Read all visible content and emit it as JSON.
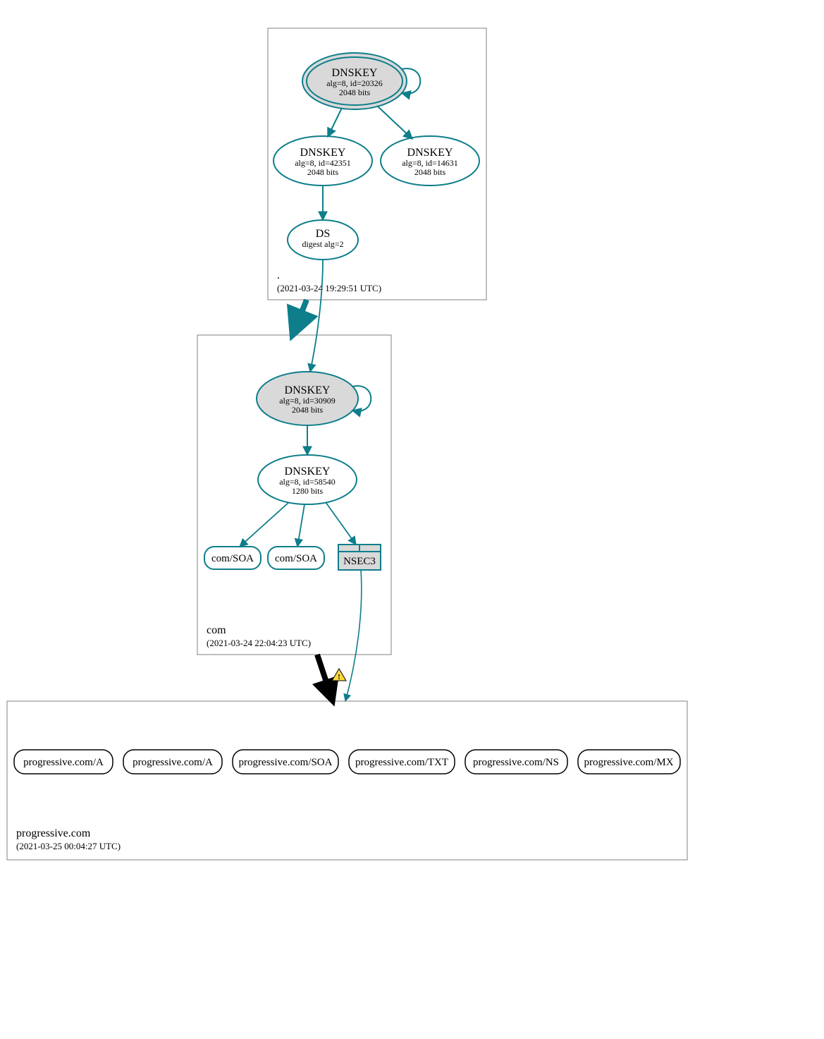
{
  "colors": {
    "teal": "#0d7e8a",
    "fill_grey": "#d9d9d9",
    "box_grey": "#808080",
    "black": "#000000",
    "warn_yellow": "#ffd83d",
    "warn_border": "#000000"
  },
  "zones": {
    "root": {
      "name": ".",
      "timestamp": "(2021-03-24 19:29:51 UTC)",
      "dnskeys": [
        {
          "title": "DNSKEY",
          "alg_id": "alg=8, id=20326",
          "bits": "2048 bits",
          "ksk": true
        },
        {
          "title": "DNSKEY",
          "alg_id": "alg=8, id=42351",
          "bits": "2048 bits",
          "ksk": false
        },
        {
          "title": "DNSKEY",
          "alg_id": "alg=8, id=14631",
          "bits": "2048 bits",
          "ksk": false
        }
      ],
      "ds": {
        "title": "DS",
        "digest": "digest alg=2"
      }
    },
    "com": {
      "name": "com",
      "timestamp": "(2021-03-24 22:04:23 UTC)",
      "dnskeys": [
        {
          "title": "DNSKEY",
          "alg_id": "alg=8, id=30909",
          "bits": "2048 bits",
          "ksk": true
        },
        {
          "title": "DNSKEY",
          "alg_id": "alg=8, id=58540",
          "bits": "1280 bits",
          "ksk": false
        }
      ],
      "rrs": [
        "com/SOA",
        "com/SOA"
      ],
      "nsec3": "NSEC3"
    },
    "progressive": {
      "name": "progressive.com",
      "timestamp": "(2021-03-25 00:04:27 UTC)",
      "rrs": [
        "progressive.com/A",
        "progressive.com/A",
        "progressive.com/SOA",
        "progressive.com/TXT",
        "progressive.com/NS",
        "progressive.com/MX"
      ]
    }
  }
}
